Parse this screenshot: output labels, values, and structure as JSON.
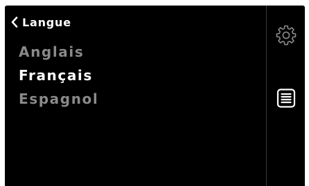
{
  "header": {
    "back_label": "Langue",
    "back_icon": "chevron-left-icon"
  },
  "languages": [
    {
      "label": "Anglais",
      "selected": false
    },
    {
      "label": "Français",
      "selected": true
    },
    {
      "label": "Espagnol",
      "selected": false
    }
  ],
  "side_icons": [
    "gear-icon",
    "list-icon"
  ],
  "colors": {
    "background": "#000000",
    "text_selected": "#ffffff",
    "text_unselected": "#8a8a8a",
    "divider": "#3c3c3c"
  }
}
